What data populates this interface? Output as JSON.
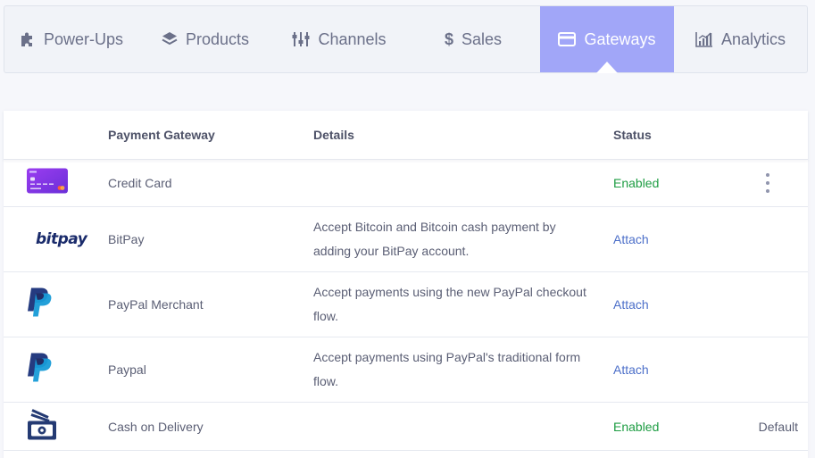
{
  "tabs": [
    {
      "label": "Power-Ups",
      "icon": "puzzle-icon"
    },
    {
      "label": "Products",
      "icon": "layers-icon"
    },
    {
      "label": "Channels",
      "icon": "channels-icon"
    },
    {
      "label": "Sales",
      "icon": "dollar-icon"
    },
    {
      "label": "Gateways",
      "icon": "credit-card-icon",
      "active": true
    },
    {
      "label": "Analytics",
      "icon": "bar-chart-icon"
    }
  ],
  "table": {
    "headers": {
      "name": "Payment Gateway",
      "details": "Details",
      "status": "Status"
    },
    "rows": [
      {
        "name": "Credit Card",
        "details": "",
        "status": "Enabled",
        "logo": "credit-card-logo",
        "extra": ""
      },
      {
        "name": "BitPay",
        "details": "Accept Bitcoin and Bitcoin cash payment by adding your BitPay account.",
        "status": "Attach",
        "logo": "bitpay-logo",
        "logo_text": "bitpay",
        "extra": ""
      },
      {
        "name": "PayPal Merchant",
        "details": "Accept payments using the new PayPal checkout flow.",
        "status": "Attach",
        "logo": "paypal-logo",
        "extra": ""
      },
      {
        "name": "Paypal",
        "details": "Accept payments using PayPal's traditional form flow.",
        "status": "Attach",
        "logo": "paypal-logo",
        "extra": ""
      },
      {
        "name": "Cash on Delivery",
        "details": "",
        "status": "Enabled",
        "logo": "cash-logo",
        "extra": "Default"
      }
    ]
  },
  "colors": {
    "accent": "#a1a6f8",
    "enabled": "#1e9d43",
    "attach": "#4c6fc9"
  }
}
